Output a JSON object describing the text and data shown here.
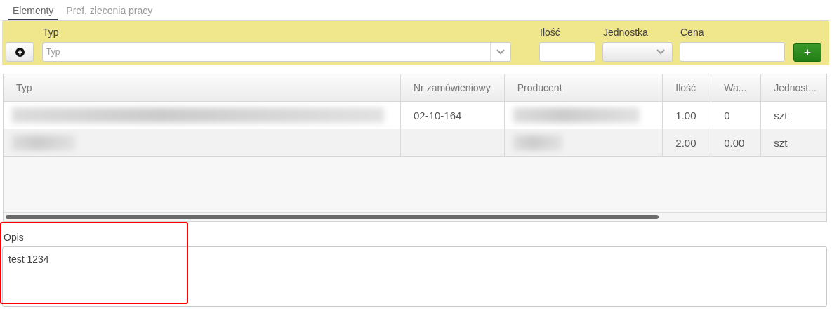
{
  "tabs": [
    {
      "label": "Elementy",
      "selected": true
    },
    {
      "label": "Pref. zlecenia pracy",
      "selected": false
    }
  ],
  "form": {
    "fields": [
      {
        "kind": "combo",
        "label": "Typ",
        "placeholder": "Typ"
      },
      {
        "kind": "text",
        "label": "Ilość"
      },
      {
        "kind": "select",
        "label": "Jednostka"
      },
      {
        "kind": "text",
        "label": "Cena"
      }
    ],
    "add_button": "+"
  },
  "table": {
    "columns": [
      "Typ",
      "Nr zamówieniowy",
      "Producent",
      "Ilość",
      "Wa...",
      "Jednost..."
    ],
    "rows": [
      {
        "cells": [
          {
            "redacted": true
          },
          {
            "text": "02-10-164"
          },
          {
            "redacted": true
          },
          {
            "text": "1.00"
          },
          {
            "text": "0"
          },
          {
            "text": "szt"
          }
        ]
      },
      {
        "cells": [
          {
            "redacted": true
          },
          {},
          {
            "redacted": true
          },
          {
            "text": "2.00"
          },
          {
            "text": "0.00"
          },
          {
            "text": "szt"
          }
        ]
      }
    ]
  },
  "description": {
    "label": "Opis",
    "value": "test 1234",
    "highlighted": true
  }
}
